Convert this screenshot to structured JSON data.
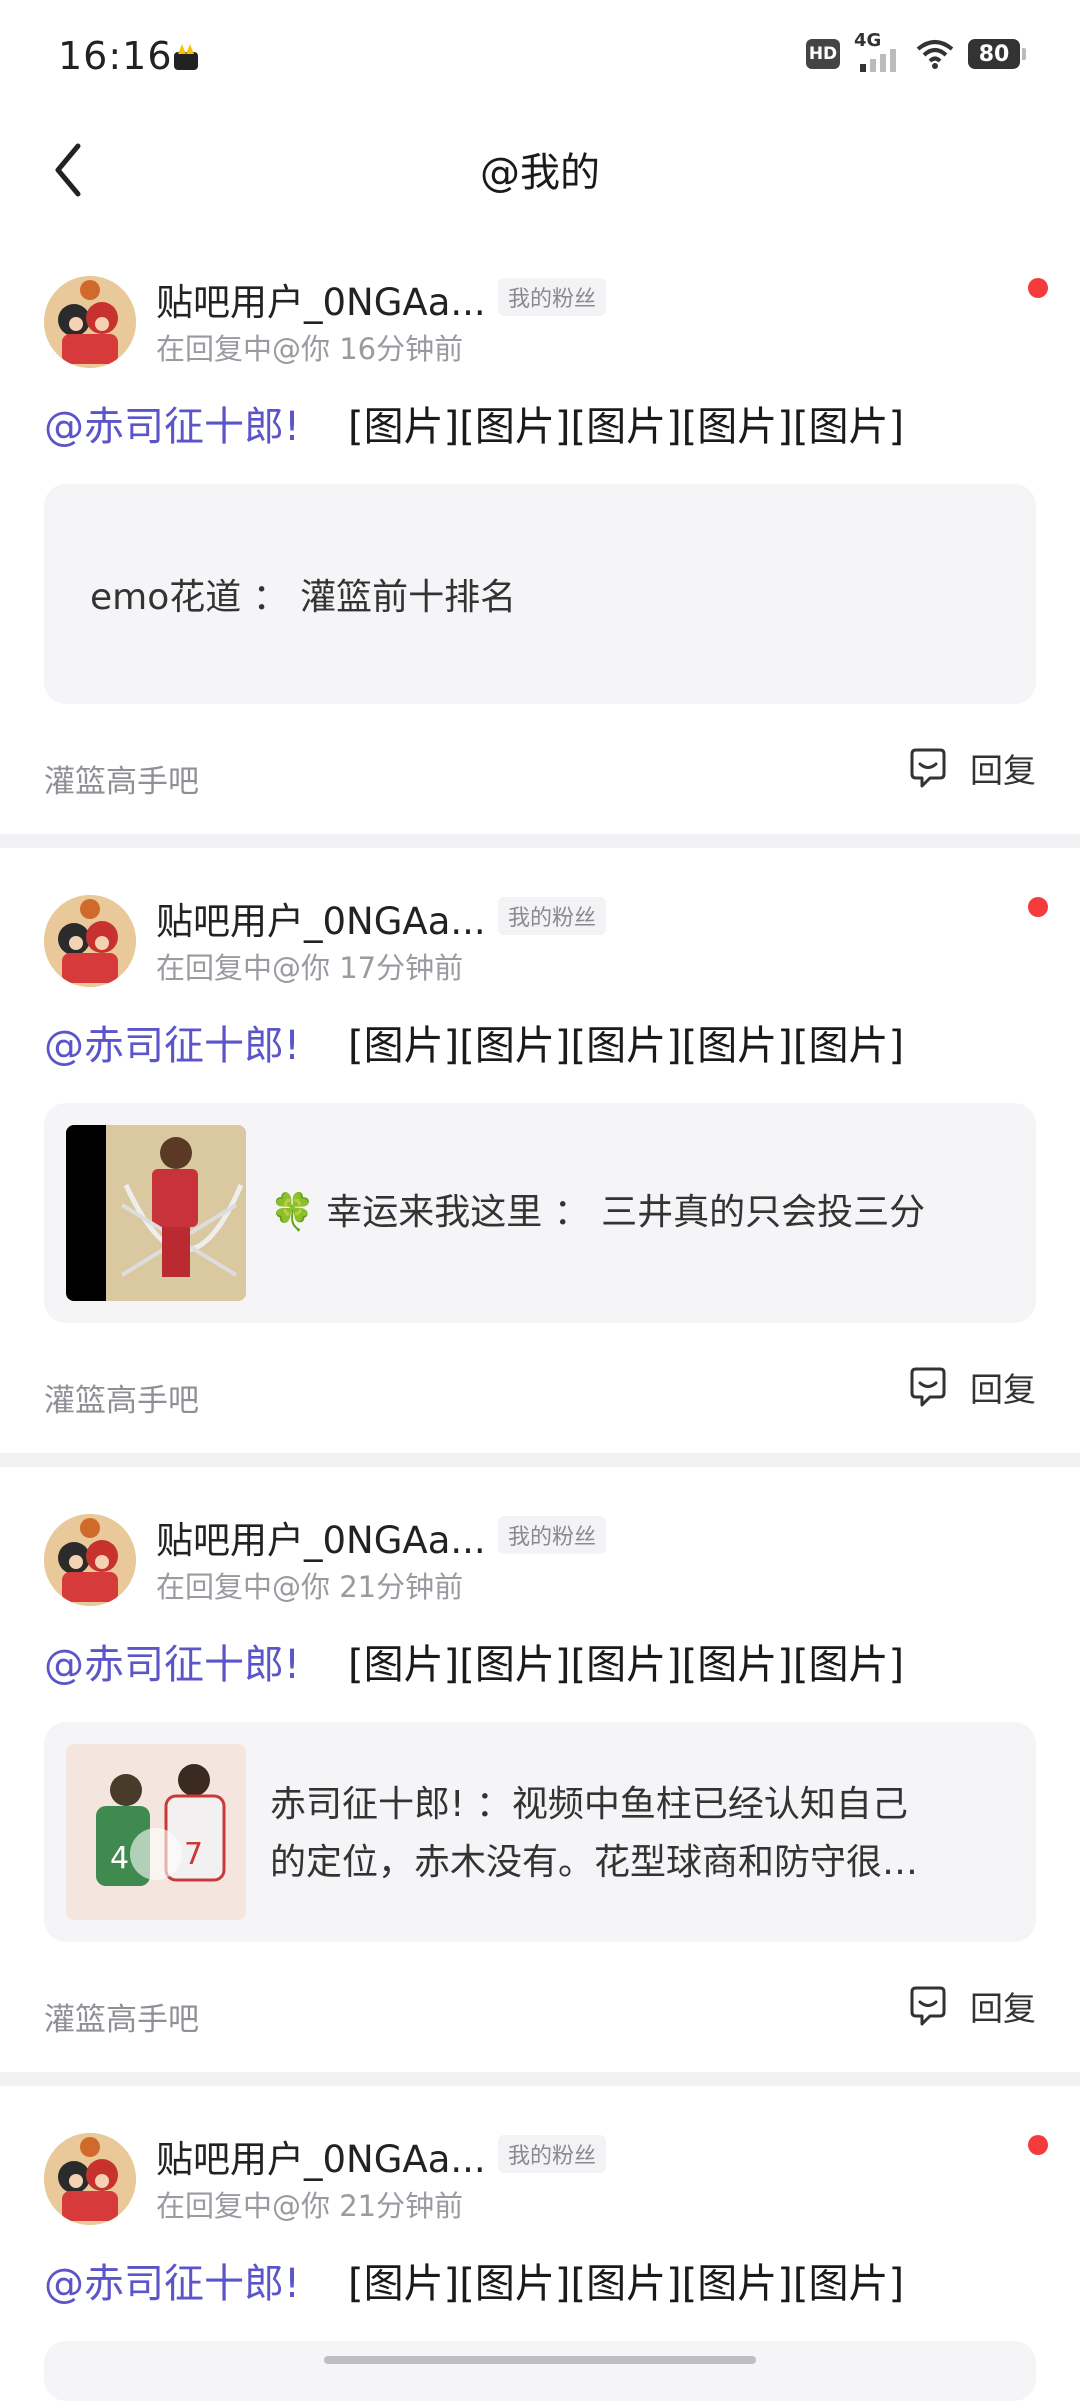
{
  "status_bar": {
    "time": "16:16",
    "hd": "HD",
    "network": "4G",
    "battery": "80"
  },
  "header": {
    "title": "@我的"
  },
  "cards": [
    {
      "username": "贴吧用户_0NGAa...",
      "badge": "我的粉丝",
      "meta": "在回复中@你  16分钟前",
      "mention": "@赤司征十郎!",
      "pics": "[图片][图片][图片][图片][图片]",
      "quote_lines": [
        "emo花道 ： 灌篮前十排名"
      ],
      "forum": "灌篮高手吧",
      "reply_label": "回复"
    },
    {
      "username": "贴吧用户_0NGAa...",
      "badge": "我的粉丝",
      "meta": "在回复中@你  17分钟前",
      "mention": "@赤司征十郎!",
      "pics": "[图片][图片][图片][图片][图片]",
      "quote_lines": [
        "🍀 幸运来我这里 ： 三井真的只会投三分"
      ],
      "forum": "灌篮高手吧",
      "reply_label": "回复"
    },
    {
      "username": "贴吧用户_0NGAa...",
      "badge": "我的粉丝",
      "meta": "在回复中@你  21分钟前",
      "mention": "@赤司征十郎!",
      "pics": "[图片][图片][图片][图片][图片]",
      "quote_lines": [
        "赤司征十郎! ：视频中鱼柱已经认知自己",
        "的定位，赤木没有。花型球商和防守很…"
      ],
      "forum": "灌篮高手吧",
      "reply_label": "回复"
    },
    {
      "username": "贴吧用户_0NGAa...",
      "badge": "我的粉丝",
      "meta": "在回复中@你  21分钟前",
      "mention": "@赤司征十郎!",
      "pics": "[图片][图片][图片][图片][图片]"
    }
  ],
  "colors": {
    "mention": "#5b55c9",
    "unread_dot": "#f43a3a",
    "separator": "#f2f2f5"
  }
}
